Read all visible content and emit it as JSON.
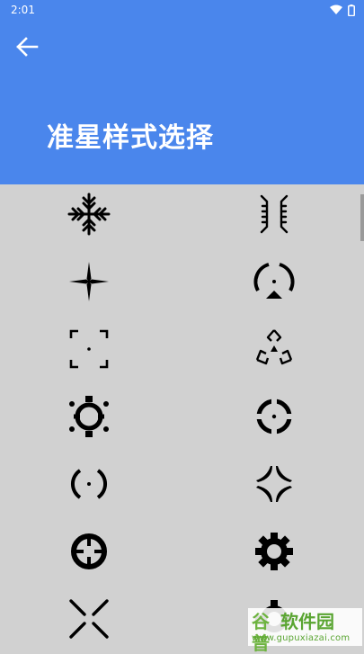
{
  "status_bar": {
    "time": "2:01"
  },
  "header": {
    "title": "准星样式选择",
    "back_icon": "arrow-left-icon",
    "color": "#4a86ec"
  },
  "grid": {
    "background": "#d1d1d1",
    "items": [
      "snowflake-crosshair-icon",
      "bracket-gate-crosshair-icon",
      "propeller-crosshair-icon",
      "broken-circle-dot-crosshair-icon",
      "corner-brackets-dot-crosshair-icon",
      "triangle-chevron-crosshair-icon",
      "ring-with-feet-crosshair-icon",
      "split-circle-dot-crosshair-icon",
      "parentheses-dot-crosshair-icon",
      "four-arc-star-crosshair-icon",
      "bold-ring-ticks-crosshair-icon",
      "gear-crosshair-icon",
      "x-cross-crosshair-icon",
      "gear-partial-crosshair-icon"
    ]
  },
  "watermark": {
    "logo": "谷普",
    "title": "软件园",
    "url": "www.gupuxiazai.com"
  }
}
